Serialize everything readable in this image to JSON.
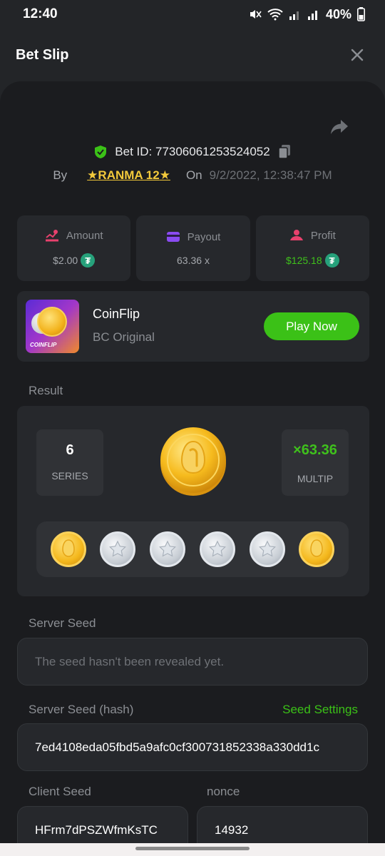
{
  "status": {
    "time": "12:40",
    "battery": "40%"
  },
  "header": {
    "title": "Bet Slip"
  },
  "bet": {
    "id_label": "Bet ID:",
    "id": "77306061253524052",
    "by_label": "By",
    "user": "RANMA 12",
    "on_label": "On",
    "date": "9/2/2022, 12:38:47 PM"
  },
  "stats": {
    "amount_label": "Amount",
    "amount": "$2.00",
    "payout_label": "Payout",
    "payout": "63.36 x",
    "profit_label": "Profit",
    "profit": "$125.18"
  },
  "game": {
    "thumb_text": "COINFLIP",
    "name": "CoinFlip",
    "provider": "BC Original",
    "play_label": "Play Now"
  },
  "result": {
    "label": "Result",
    "series_value": "6",
    "series_label": "SERIES",
    "multiplier_value": "×63.36",
    "multiplier_label": "MULTIP",
    "history": [
      "gold",
      "silver",
      "silver",
      "silver",
      "silver",
      "gold"
    ]
  },
  "server_seed": {
    "label": "Server Seed",
    "value": "The seed hasn't been revealed yet."
  },
  "server_seed_hash": {
    "label": "Server Seed (hash)",
    "settings_label": "Seed Settings",
    "value": "7ed4108eda05fbd5a9afc0cf300731852338a330dd1c"
  },
  "client_seed": {
    "label": "Client Seed",
    "value": "HFrm7dPSZWfmKsTC"
  },
  "nonce": {
    "label": "nonce",
    "value": "14932"
  },
  "colors": {
    "accent": "#3bc117",
    "gold": "#f3c93b",
    "background": "#1b1c1f",
    "card": "#26282c"
  }
}
